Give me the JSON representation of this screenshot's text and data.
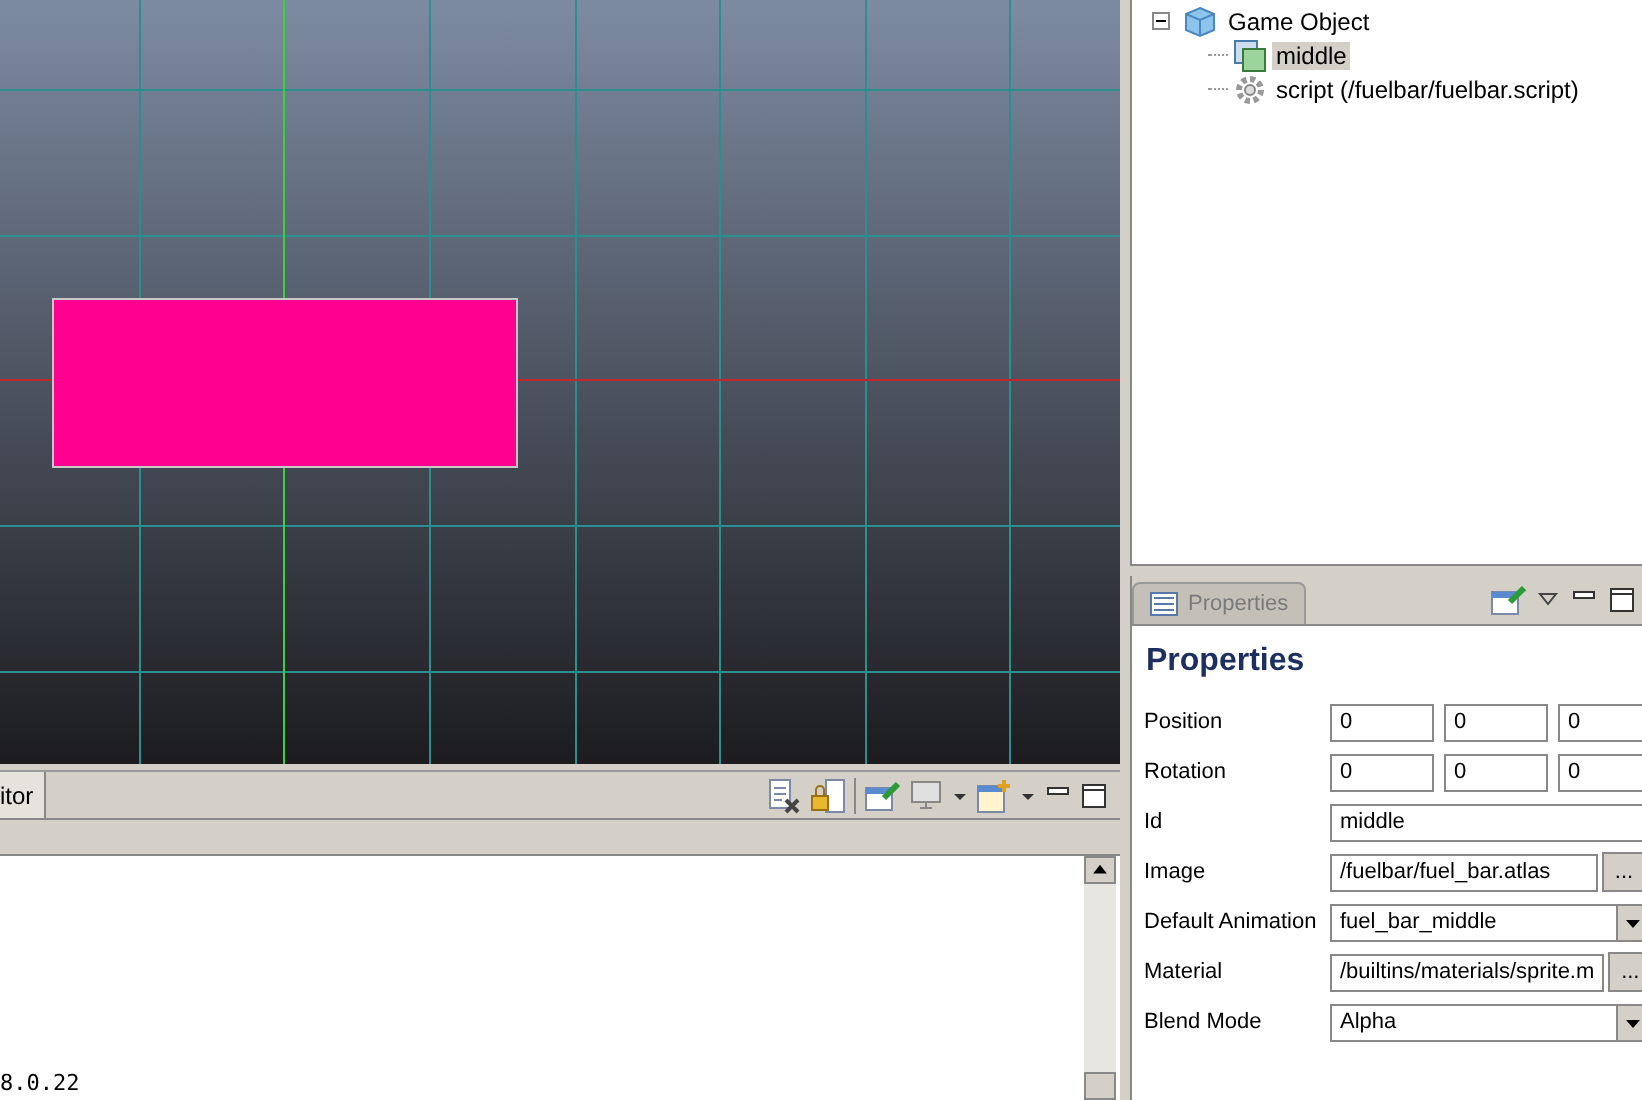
{
  "console": {
    "tab": "itor",
    "output": "8.0.22"
  },
  "outline": {
    "items": [
      {
        "label": "Game Object",
        "kind": "gameobject",
        "expanded": true,
        "selected": false,
        "children": [
          {
            "label": "middle",
            "kind": "sprite",
            "selected": true
          },
          {
            "label": "script (/fuelbar/fuelbar.script)",
            "kind": "script",
            "selected": false
          }
        ]
      }
    ]
  },
  "properties": {
    "tab": "Properties",
    "heading": "Properties",
    "fields": [
      {
        "label": "Position",
        "kind": "vector",
        "values": [
          "0",
          "0",
          "0"
        ]
      },
      {
        "label": "Rotation",
        "kind": "vector",
        "values": [
          "0",
          "0",
          "0"
        ]
      },
      {
        "label": "Id",
        "kind": "text",
        "value": "middle"
      },
      {
        "label": "Image",
        "kind": "resource",
        "value": "/fuelbar/fuel_bar.atlas",
        "button": "..."
      },
      {
        "label": "Default Animation",
        "kind": "dropdown",
        "value": "fuel_bar_middle"
      },
      {
        "label": "Material",
        "kind": "resource",
        "value": "/builtins/materials/sprite.m",
        "button": "..."
      },
      {
        "label": "Blend Mode",
        "kind": "dropdown",
        "value": "Alpha"
      }
    ]
  }
}
